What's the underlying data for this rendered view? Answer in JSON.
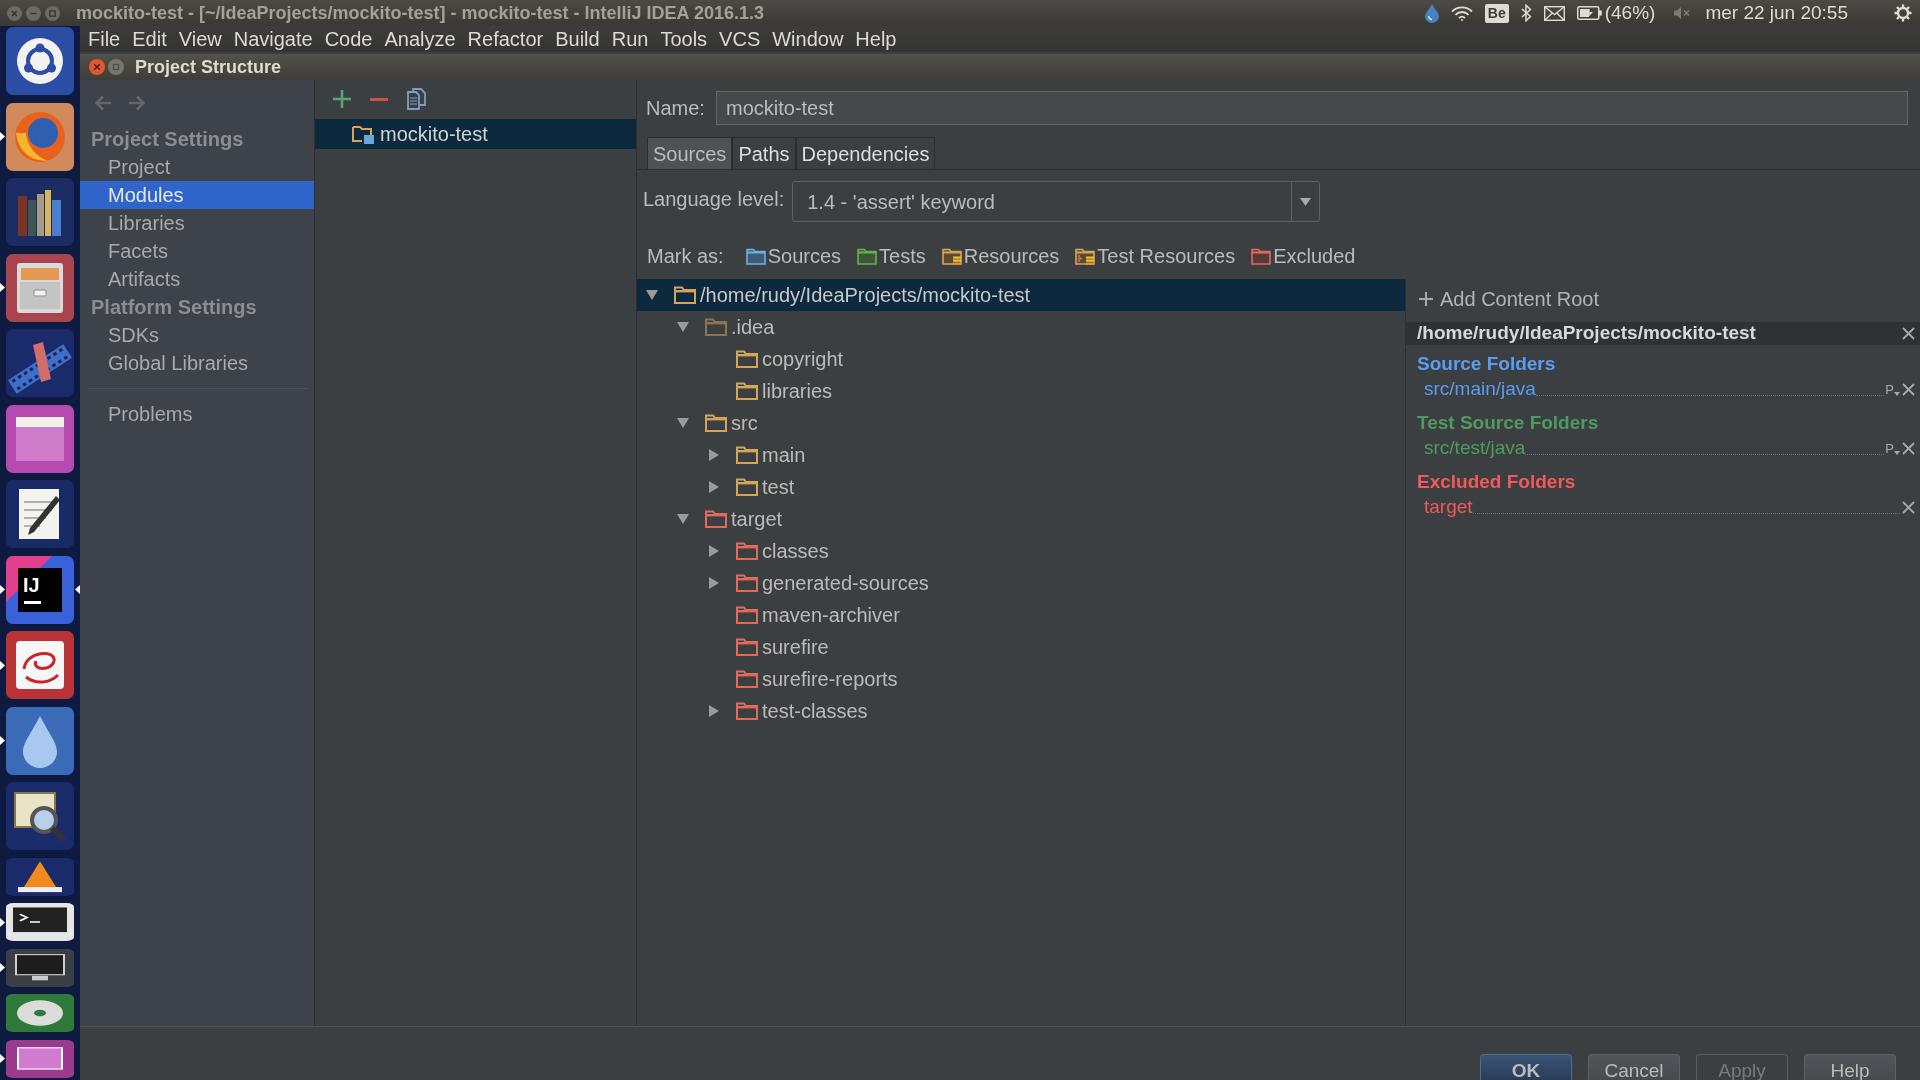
{
  "top_panel": {
    "title": "mockito-test - [~/IdeaProjects/mockito-test] - mockito-test - IntelliJ IDEA 2016.1.3",
    "indicators": [
      {
        "kind": "drop"
      },
      {
        "kind": "wifi"
      },
      {
        "kind": "keyboard",
        "text": "Be"
      },
      {
        "kind": "bluetooth"
      },
      {
        "kind": "mail"
      },
      {
        "kind": "battery"
      },
      {
        "kind": "percentage",
        "text": "(46%)"
      },
      {
        "kind": "muted"
      },
      {
        "kind": "clock",
        "text": "mer 22 jun 20:55"
      },
      {
        "kind": "gear"
      }
    ]
  },
  "menu_bar": [
    {
      "label": "File"
    },
    {
      "label": "Edit"
    },
    {
      "label": "View"
    },
    {
      "label": "Navigate"
    },
    {
      "label": "Code"
    },
    {
      "label": "Analyze"
    },
    {
      "label": "Refactor"
    },
    {
      "label": "Build"
    },
    {
      "label": "Run"
    },
    {
      "label": "Tools"
    },
    {
      "label": "VCS"
    },
    {
      "label": "Window"
    },
    {
      "label": "Help"
    }
  ],
  "launcher": [
    {
      "kind": "ring",
      "running": false,
      "selected": false
    },
    {
      "kind": "globe",
      "running": true,
      "selected": false
    },
    {
      "kind": "books",
      "running": false,
      "selected": false
    },
    {
      "kind": "cabinet",
      "running": true,
      "selected": false
    },
    {
      "kind": "film",
      "running": false,
      "selected": false
    },
    {
      "kind": "window",
      "running": false,
      "selected": false
    },
    {
      "kind": "notepad",
      "running": false,
      "selected": false
    },
    {
      "kind": "ij",
      "text": "IJ",
      "running": true,
      "selected": true
    },
    {
      "kind": "swirl",
      "running": true,
      "selected": false
    },
    {
      "kind": "drop",
      "running": true,
      "selected": false
    },
    {
      "kind": "magnifier",
      "running": false,
      "selected": false
    },
    {
      "kind": "cone",
      "running": false,
      "selected": false
    },
    {
      "kind": "terminal",
      "running": true,
      "selected": false
    },
    {
      "kind": "screen",
      "running": true,
      "selected": false
    },
    {
      "kind": "disc",
      "running": false,
      "selected": false
    },
    {
      "kind": "panel",
      "running": true,
      "selected": false
    }
  ],
  "dialog": {
    "title": "Project Structure",
    "sidebar": {
      "groups": [
        {
          "title": "Project Settings",
          "items": [
            {
              "label": "Project",
              "selected": false
            },
            {
              "label": "Modules",
              "selected": true
            },
            {
              "label": "Libraries",
              "selected": false
            },
            {
              "label": "Facets",
              "selected": false
            },
            {
              "label": "Artifacts",
              "selected": false
            }
          ]
        },
        {
          "title": "Platform Settings",
          "items": [
            {
              "label": "SDKs",
              "selected": false
            },
            {
              "label": "Global Libraries",
              "selected": false
            }
          ]
        }
      ],
      "footer_items": [
        {
          "label": "Problems",
          "selected": false
        }
      ]
    },
    "modules": [
      {
        "name": "mockito-test",
        "selected": true
      }
    ],
    "name_field": {
      "label": "Name:",
      "value": "mockito-test"
    },
    "tabs": [
      {
        "label": "Sources",
        "selected": true
      },
      {
        "label": "Paths",
        "selected": false
      },
      {
        "label": "Dependencies",
        "selected": false
      }
    ],
    "language_level": {
      "label": "Language level:",
      "value": "1.4 - 'assert' keyword"
    },
    "mark_as": {
      "label": "Mark as:",
      "buttons": [
        {
          "kind": "sources",
          "label": "Sources"
        },
        {
          "kind": "tests",
          "label": "Tests"
        },
        {
          "kind": "resources",
          "label": "Resources"
        },
        {
          "kind": "test_resources",
          "label": "Test Resources"
        },
        {
          "kind": "excluded",
          "label": "Excluded"
        }
      ]
    },
    "tree": [
      {
        "label": "/home/rudy/IdeaProjects/mockito-test",
        "color": "#d4a45c",
        "expandable": true,
        "expanded": true,
        "selected": true,
        "children": [
          {
            "label": ".idea",
            "color": "#8a7552",
            "expandable": true,
            "expanded": true,
            "selected": false,
            "children": [
              {
                "label": "copyright",
                "color": "#d4a45c",
                "expandable": false,
                "selected": false
              },
              {
                "label": "libraries",
                "color": "#d4a45c",
                "expandable": false,
                "selected": false
              }
            ]
          },
          {
            "label": "src",
            "color": "#d4a45c",
            "expandable": true,
            "expanded": true,
            "selected": false,
            "children": [
              {
                "label": "main",
                "color": "#d4a45c",
                "expandable": true,
                "expanded": false,
                "selected": false
              },
              {
                "label": "test",
                "color": "#d4a45c",
                "expandable": true,
                "expanded": false,
                "selected": false
              }
            ]
          },
          {
            "label": "target",
            "color": "#df6b5d",
            "expandable": true,
            "expanded": true,
            "selected": false,
            "children": [
              {
                "label": "classes",
                "color": "#df6b5d",
                "expandable": true,
                "expanded": false,
                "selected": false
              },
              {
                "label": "generated-sources",
                "color": "#df6b5d",
                "expandable": true,
                "expanded": false,
                "selected": false
              },
              {
                "label": "maven-archiver",
                "color": "#df6b5d",
                "expandable": false,
                "selected": false
              },
              {
                "label": "surefire",
                "color": "#df6b5d",
                "expandable": false,
                "selected": false
              },
              {
                "label": "surefire-reports",
                "color": "#df6b5d",
                "expandable": false,
                "selected": false
              },
              {
                "label": "test-classes",
                "color": "#df6b5d",
                "expandable": true,
                "expanded": false,
                "selected": false
              }
            ]
          }
        ]
      }
    ],
    "content_root": {
      "add_label": "Add Content Root",
      "path": "/home/rudy/IdeaProjects/mockito-test",
      "sections": [
        {
          "title": "Source Folders",
          "color": "#5a9cf0",
          "folders": [
            {
              "path": "src/main/java",
              "prefix": "P"
            }
          ]
        },
        {
          "title": "Test Source Folders",
          "color": "#4f9a5e",
          "folders": [
            {
              "path": "src/test/java",
              "prefix": "P"
            }
          ]
        },
        {
          "title": "Excluded Folders",
          "color": "#f05a5a",
          "folders": [
            {
              "path": "target"
            }
          ]
        }
      ]
    },
    "buttons": [
      {
        "label": "OK",
        "default": true,
        "disabled": false
      },
      {
        "label": "Cancel",
        "default": false,
        "disabled": false
      },
      {
        "label": "Apply",
        "default": false,
        "disabled": true
      },
      {
        "label": "Help",
        "default": false,
        "disabled": false
      }
    ]
  }
}
